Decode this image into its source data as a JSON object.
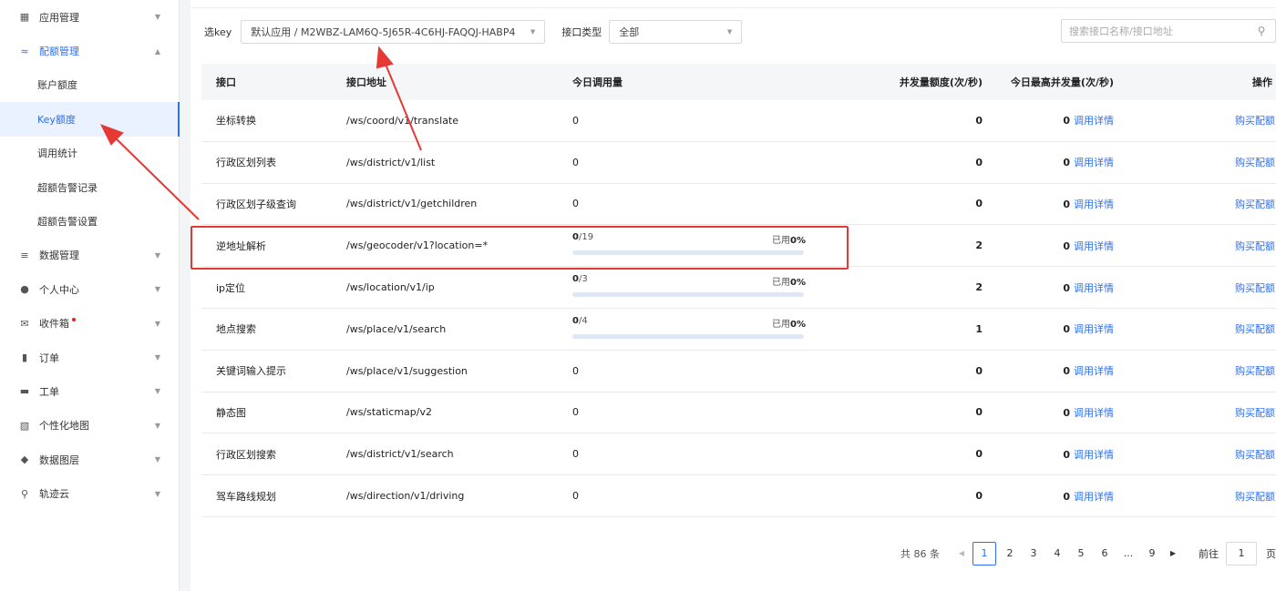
{
  "sidebar": {
    "items": [
      {
        "label": "应用管理",
        "icon": "grid-icon",
        "chevron": "▼"
      },
      {
        "label": "配额管理",
        "icon": "chart-icon",
        "chevron": "▲"
      },
      {
        "label": "账户额度"
      },
      {
        "label": "Key额度"
      },
      {
        "label": "调用统计"
      },
      {
        "label": "超额告警记录"
      },
      {
        "label": "超额告警设置"
      },
      {
        "label": "数据管理",
        "icon": "database-icon",
        "chevron": "▼"
      },
      {
        "label": "个人中心",
        "icon": "user-icon",
        "chevron": "▼"
      },
      {
        "label": "收件箱",
        "icon": "mail-icon",
        "chevron": "▼"
      },
      {
        "label": "订单",
        "icon": "clipboard-icon",
        "chevron": "▼"
      },
      {
        "label": "工单",
        "icon": "ticket-icon",
        "chevron": "▼"
      },
      {
        "label": "个性化地图",
        "icon": "map-style-icon",
        "chevron": "▼"
      },
      {
        "label": "数据图层",
        "icon": "layers-icon",
        "chevron": "▼"
      },
      {
        "label": "轨迹云",
        "icon": "track-icon",
        "chevron": "▼"
      }
    ]
  },
  "filter": {
    "key_label": "选key",
    "key_value": "默认应用 / M2WBZ-LAM6Q-5J65R-4C6HJ-FAQQJ-HABP4",
    "type_label": "接口类型",
    "type_value": "全部",
    "search_placeholder": "搜索接口名称/接口地址"
  },
  "table": {
    "headers": [
      "接口",
      "接口地址",
      "今日调用量",
      "并发量额度(次/秒)",
      "今日最高并发量(次/秒)",
      "操作"
    ],
    "rows": [
      {
        "name": "坐标转换",
        "path": "/ws/coord/v1/translate",
        "calls": "0",
        "quota": "0",
        "peak": "0",
        "detail": "调用详情",
        "action": "购买配额"
      },
      {
        "name": "行政区划列表",
        "path": "/ws/district/v1/list",
        "calls": "0",
        "quota": "0",
        "peak": "0",
        "detail": "调用详情",
        "action": "购买配额"
      },
      {
        "name": "行政区划子级查询",
        "path": "/ws/district/v1/getchildren",
        "calls": "0",
        "quota": "0",
        "peak": "0",
        "detail": "调用详情",
        "action": "购买配额"
      },
      {
        "name": "逆地址解析",
        "path": "/ws/geocoder/v1?location=*",
        "used": "0",
        "total": "/19",
        "pct_label": "已用",
        "pct": "0%",
        "fraction": 0,
        "quota": "2",
        "peak": "0",
        "detail": "调用详情",
        "action": "购买配额"
      },
      {
        "name": "ip定位",
        "path": "/ws/location/v1/ip",
        "used": "0",
        "total": "/3",
        "pct_label": "已用",
        "pct": "0%",
        "fraction": 0,
        "quota": "2",
        "peak": "0",
        "detail": "调用详情",
        "action": "购买配额"
      },
      {
        "name": "地点搜索",
        "path": "/ws/place/v1/search",
        "used": "0",
        "total": "/4",
        "pct_label": "已用",
        "pct": "0%",
        "fraction": 0,
        "quota": "1",
        "peak": "0",
        "detail": "调用详情",
        "action": "购买配额"
      },
      {
        "name": "关键词输入提示",
        "path": "/ws/place/v1/suggestion",
        "calls": "0",
        "quota": "0",
        "peak": "0",
        "detail": "调用详情",
        "action": "购买配额"
      },
      {
        "name": "静态图",
        "path": "/ws/staticmap/v2",
        "calls": "0",
        "quota": "0",
        "peak": "0",
        "detail": "调用详情",
        "action": "购买配额"
      },
      {
        "name": "行政区划搜索",
        "path": "/ws/district/v1/search",
        "calls": "0",
        "quota": "0",
        "peak": "0",
        "detail": "调用详情",
        "action": "购买配额"
      },
      {
        "name": "驾车路线规划",
        "path": "/ws/direction/v1/driving",
        "calls": "0",
        "quota": "0",
        "peak": "0",
        "detail": "调用详情",
        "action": "购买配额"
      }
    ]
  },
  "pager": {
    "total": "共 86 条",
    "pages": [
      "1",
      "2",
      "3",
      "4",
      "5",
      "6",
      "...",
      "9"
    ],
    "current": "1",
    "goto_label": "前往",
    "goto_value": "1",
    "page_suffix": "页"
  },
  "colors": {
    "accent": "#2b6ff0",
    "highlight": "#e53935"
  }
}
